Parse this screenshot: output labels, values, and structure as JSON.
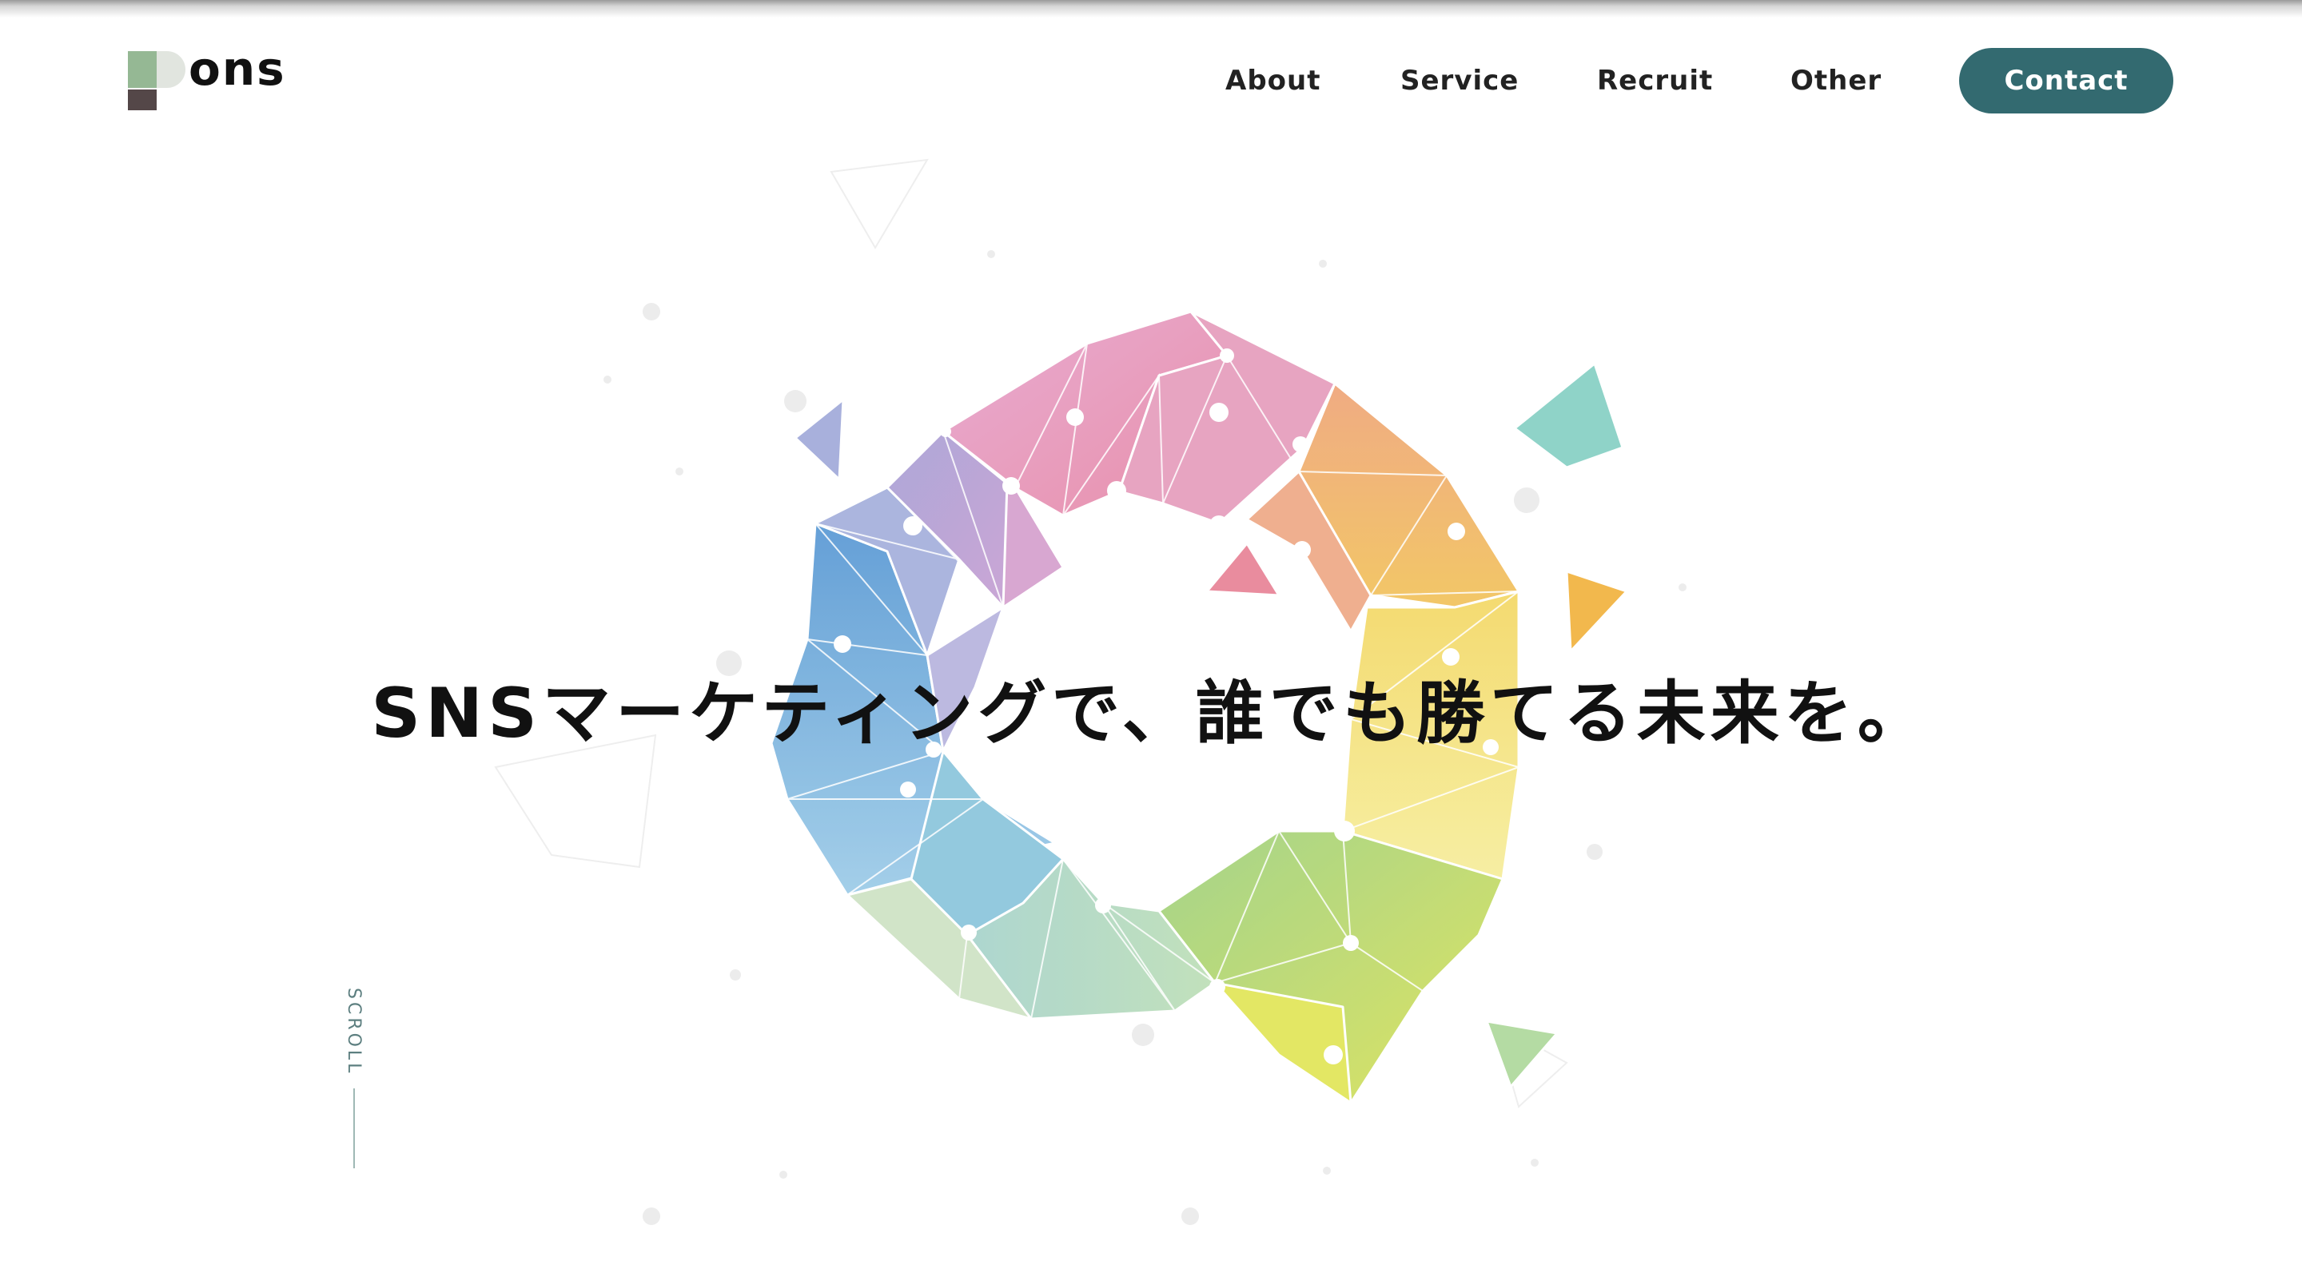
{
  "header": {
    "logo_text": "ons",
    "nav": [
      {
        "label": "About"
      },
      {
        "label": "Service"
      },
      {
        "label": "Recruit"
      },
      {
        "label": "Other"
      }
    ],
    "contact_label": "Contact"
  },
  "hero": {
    "headline": "SNSマーケティングで、誰でも勝てる未来を。",
    "scroll_label": "SCROLL"
  },
  "colors": {
    "brand_accent": "#336a70",
    "logo_green": "#95b894",
    "logo_brown": "#544748",
    "text": "#111111"
  }
}
